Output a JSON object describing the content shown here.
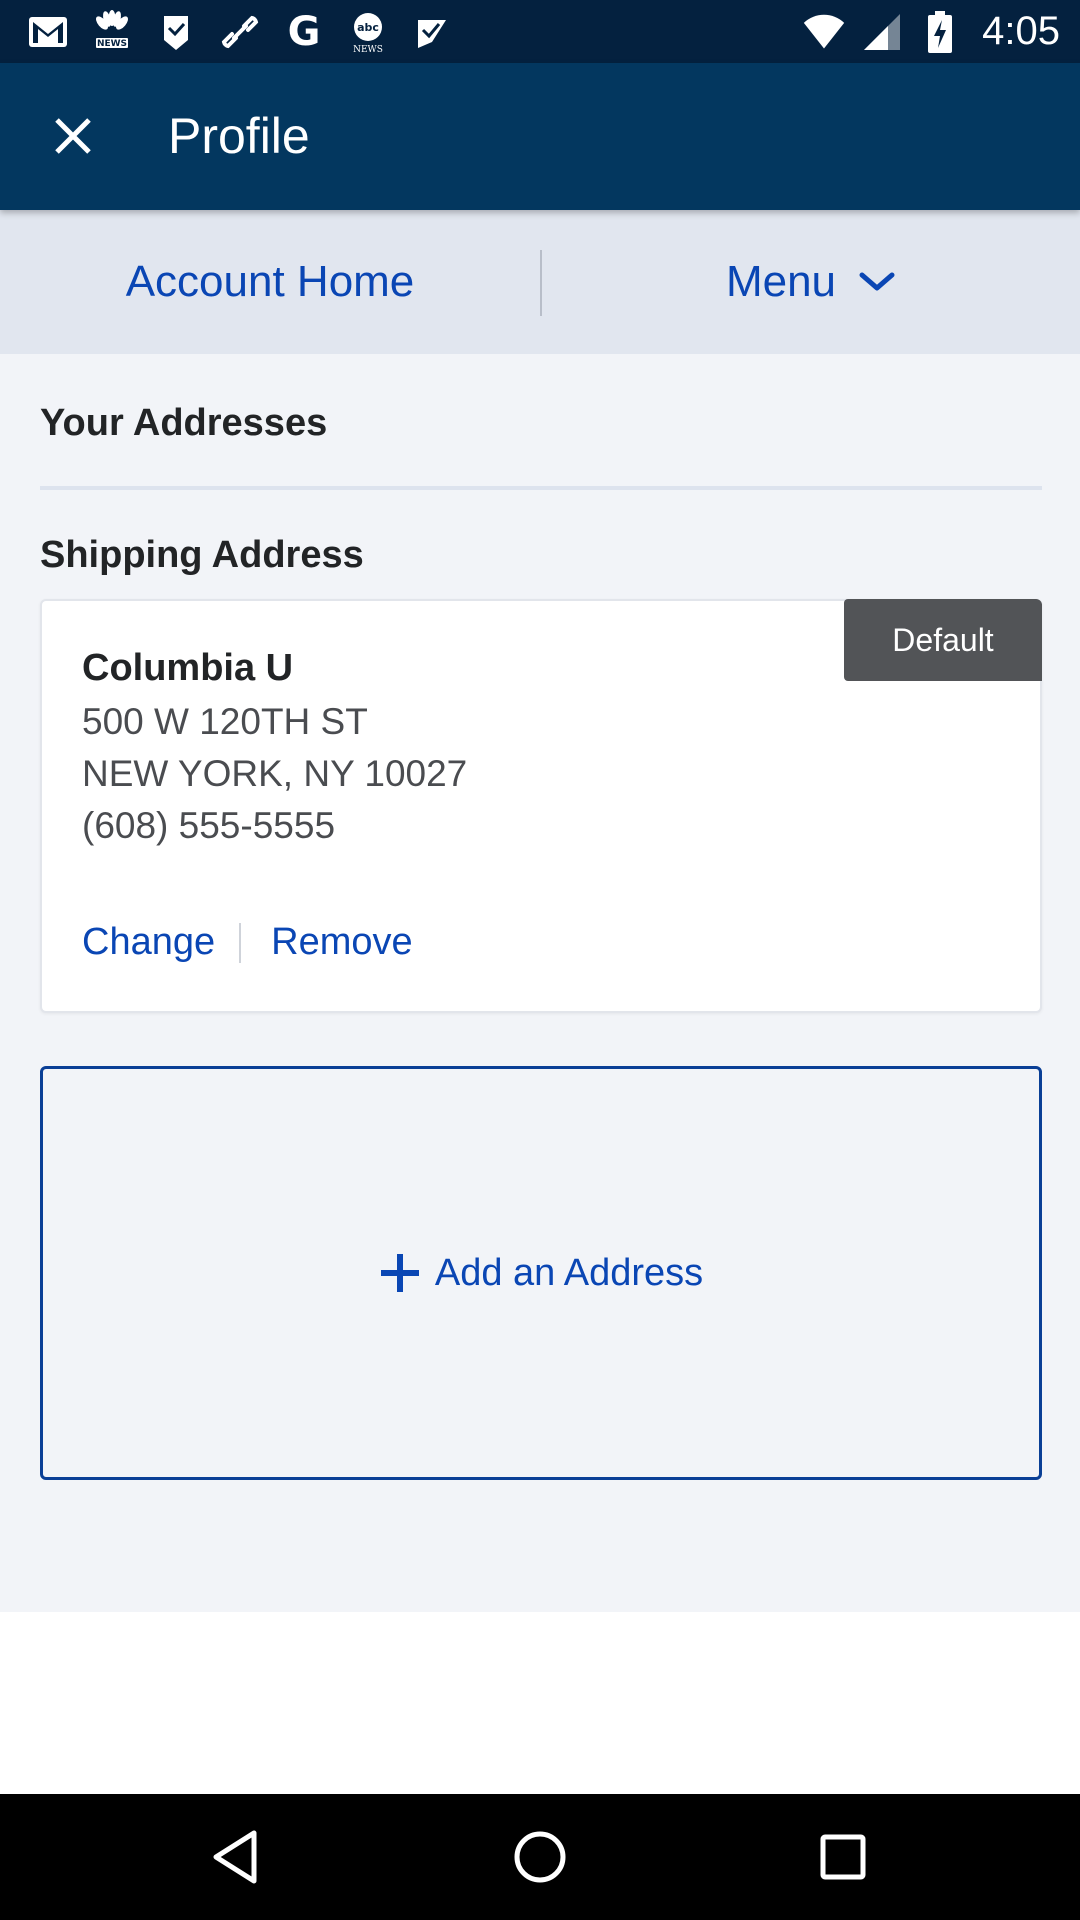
{
  "status_bar": {
    "time": "4:05",
    "left_icons": [
      "gmail-icon",
      "nbc-news-icon",
      "tag-icon",
      "link-icon",
      "google-icon",
      "abc-news-icon",
      "check-tag-icon"
    ],
    "right_icons": [
      "wifi-icon",
      "signal-icon",
      "battery-charging-icon"
    ],
    "abc_news_text": "abc",
    "news_text": "NEWS",
    "google_letter": "G"
  },
  "app_bar": {
    "title": "Profile",
    "close_icon": "close-icon"
  },
  "sub_nav": {
    "account_home": "Account Home",
    "menu": "Menu"
  },
  "content": {
    "section_title": "Your Addresses",
    "shipping_title": "Shipping Address",
    "address": {
      "badge": "Default",
      "name": "Columbia U",
      "line1": "500 W 120TH ST",
      "line2": "NEW YORK, NY 10027",
      "phone": "(608) 555-5555",
      "change_label": "Change",
      "remove_label": "Remove"
    },
    "add_address_label": "Add an Address"
  },
  "colors": {
    "status_bar": "#04213f",
    "app_bar": "#03375f",
    "link": "#0a46b4",
    "subnav_bg": "#e1e6ef",
    "content_bg": "#f2f4f8",
    "badge_bg": "#525457"
  }
}
